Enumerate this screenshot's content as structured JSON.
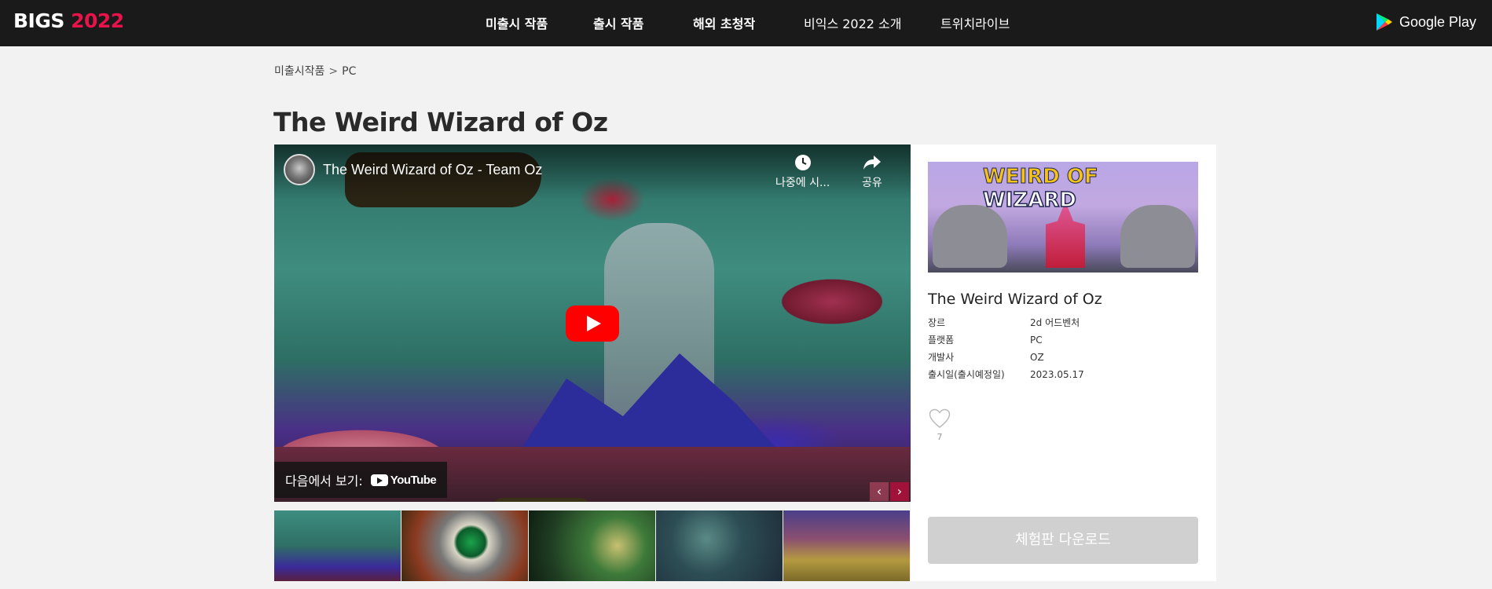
{
  "header": {
    "logo_main": "BIGS ",
    "logo_year": "2022",
    "nav": [
      {
        "label": "미출시 작품"
      },
      {
        "label": "출시 작품"
      },
      {
        "label": "해외 초청작"
      },
      {
        "label": "비익스 2022 소개"
      },
      {
        "label": "트위치라이브"
      }
    ],
    "store_label": "Google Play"
  },
  "breadcrumb": {
    "parent": "미출시작품",
    "sep": ">",
    "current": "PC"
  },
  "page_title": "The Weird Wizard of Oz",
  "video": {
    "title": "The Weird Wizard of Oz - Team Oz",
    "watch_later": "나중에 시...",
    "share": "공유",
    "watch_on": "다음에서 보기:",
    "yt_label": "YouTube"
  },
  "panel": {
    "cover_line1": "WEIRD OF",
    "cover_line2": "WIZARD",
    "name": "The Weird Wizard of Oz",
    "info": [
      {
        "key": "장르",
        "value": "2d 어드벤처"
      },
      {
        "key": "플랫폼",
        "value": "PC"
      },
      {
        "key": "개발사",
        "value": "OZ"
      },
      {
        "key": "출시일(출시예정일)",
        "value": "2023.05.17"
      }
    ],
    "likes": "7",
    "download_label": "체험판 다운로드"
  },
  "colors": {
    "brand": "#e8134a",
    "topbar": "#1a1a1a",
    "play": "#ff0000"
  }
}
